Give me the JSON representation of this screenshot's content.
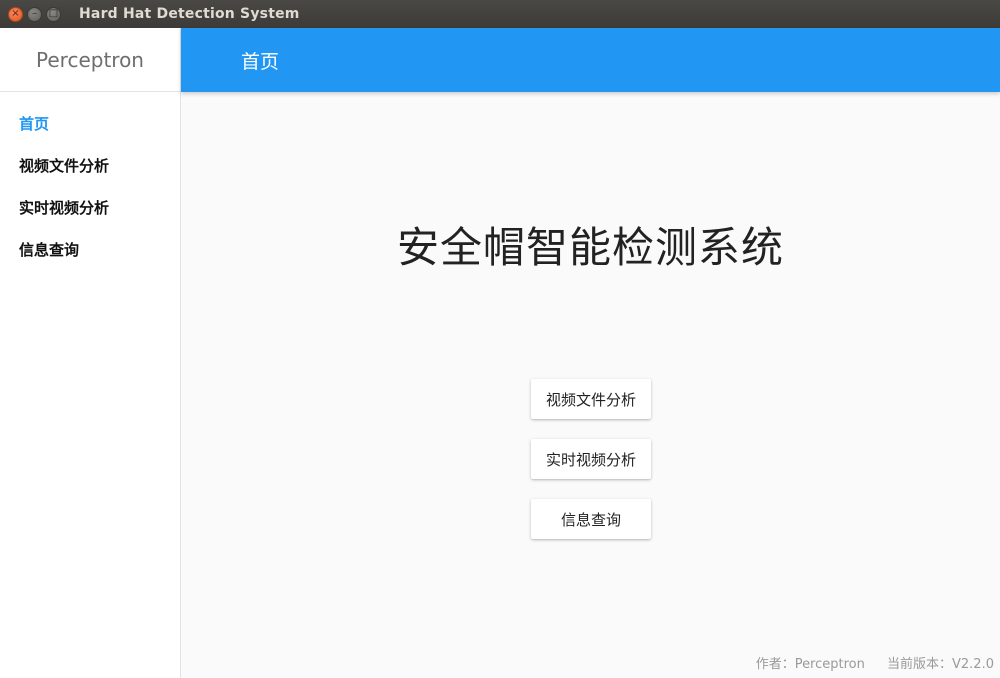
{
  "window": {
    "title": "Hard Hat Detection System",
    "controls": {
      "close": "×",
      "minimize": "–",
      "maximize": "□"
    }
  },
  "sidebar": {
    "brand": "Perceptron",
    "items": [
      {
        "label": "首页",
        "active": true
      },
      {
        "label": "视频文件分析",
        "active": false
      },
      {
        "label": "实时视频分析",
        "active": false
      },
      {
        "label": "信息查询",
        "active": false
      }
    ]
  },
  "header": {
    "title": "首页"
  },
  "main": {
    "heading": "安全帽智能检测系统",
    "buttons": {
      "video_file": "视频文件分析",
      "realtime": "实时视频分析",
      "info_query": "信息查询"
    }
  },
  "footer": {
    "author": "作者：Perceptron",
    "version": "当前版本：V2.2.0"
  },
  "colors": {
    "accent": "#2196f3",
    "background": "#fafafa",
    "titlebar": "#3c3b37",
    "close_button": "#e0541e"
  }
}
